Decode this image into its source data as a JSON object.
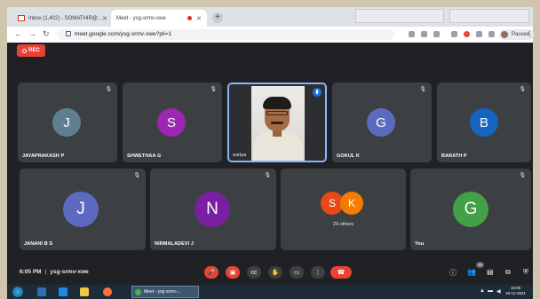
{
  "browser": {
    "tabs": [
      {
        "label": "Inbox (1,402) - SOMATHIR@...",
        "active": false
      },
      {
        "label": "Meet - ysg-srmv-xwe",
        "active": true
      }
    ],
    "url": "meet.google.com/ysg-srmv-xwe?pli=1",
    "profile_label": "Paused"
  },
  "meet": {
    "rec_label": "REC",
    "participants": [
      {
        "name": "JAYAPRAKASH P",
        "initial": "J",
        "color": "#5f7f91"
      },
      {
        "name": "SHWETHAA G",
        "initial": "S",
        "color": "#9c27b0"
      },
      {
        "name": "suriya",
        "initial": "",
        "color": "",
        "video": true,
        "speaking": true
      },
      {
        "name": "GOKUL K",
        "initial": "G",
        "color": "#5c6bc0"
      },
      {
        "name": "BARATH P",
        "initial": "B",
        "color": "#1565c0"
      },
      {
        "name": "JANANI B S",
        "initial": "J",
        "color": "#5c6bc0"
      },
      {
        "name": "NIRMALADEVI J",
        "initial": "N",
        "color": "#7b1fa2"
      },
      {
        "name": "",
        "others_label": "26 others",
        "others_initials": [
          "S",
          "K"
        ],
        "others_colors": [
          "#e64a19",
          "#f57c00"
        ]
      },
      {
        "name": "You",
        "initial": "G",
        "color": "#43a047"
      }
    ],
    "time": "6:05 PM",
    "meeting_code": "ysg-srmv-xwe",
    "participant_count": "28"
  },
  "taskbar": {
    "active_window_label": "Meet - ysg-srmv-...",
    "clock_time": "18:05",
    "clock_date": "18-12-2021"
  }
}
